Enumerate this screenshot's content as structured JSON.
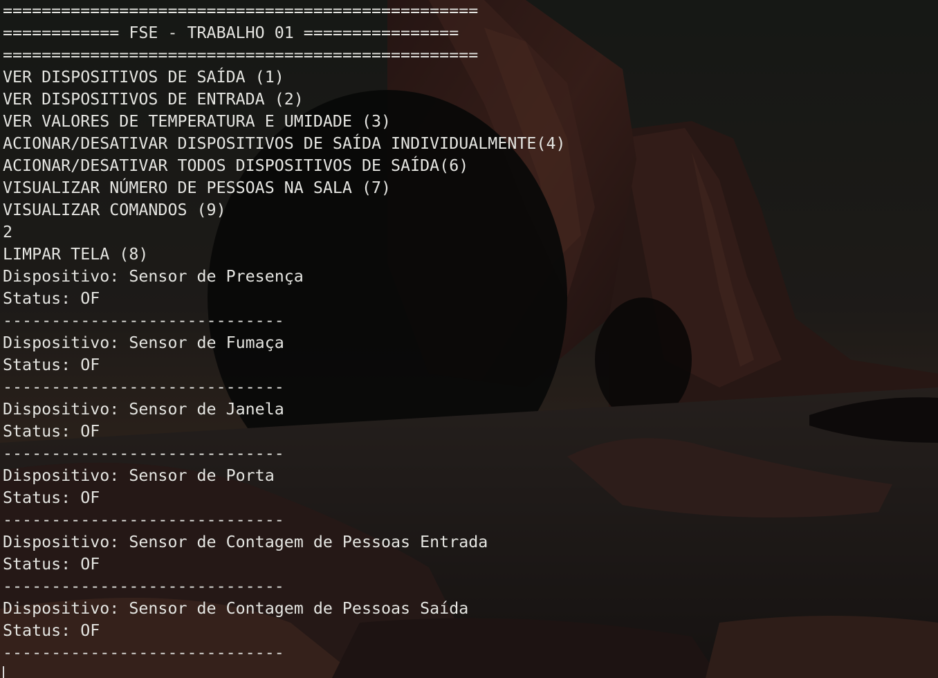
{
  "terminal": {
    "lines": [
      "=================================================",
      "============ FSE - TRABALHO 01 ================",
      "=================================================",
      "VER DISPOSITIVOS DE SAÍDA (1)",
      "VER DISPOSITIVOS DE ENTRADA (2)",
      "VER VALORES DE TEMPERATURA E UMIDADE (3)",
      "ACIONAR/DESATIVAR DISPOSITIVOS DE SAÍDA INDIVIDUALMENTE(4)",
      "ACIONAR/DESATIVAR TODOS DISPOSITIVOS DE SAÍDA(6)",
      "VISUALIZAR NÚMERO DE PESSOAS NA SALA (7)",
      "VISUALIZAR COMANDOS (9)",
      "2",
      "LIMPAR TELA (8)",
      "Dispositivo: Sensor de Presença",
      "Status: OF",
      "-----------------------------",
      "Dispositivo: Sensor de Fumaça",
      "Status: OF",
      "-----------------------------",
      "Dispositivo: Sensor de Janela",
      "Status: OF",
      "-----------------------------",
      "Dispositivo: Sensor de Porta",
      "Status: OF",
      "-----------------------------",
      "Dispositivo: Sensor de Contagem de Pessoas Entrada",
      "Status: OF",
      "-----------------------------",
      "Dispositivo: Sensor de Contagem de Pessoas Saída",
      "Status: OF",
      "-----------------------------"
    ]
  },
  "colors": {
    "text": "#e6e6e2",
    "background": "#1a1c1a"
  }
}
